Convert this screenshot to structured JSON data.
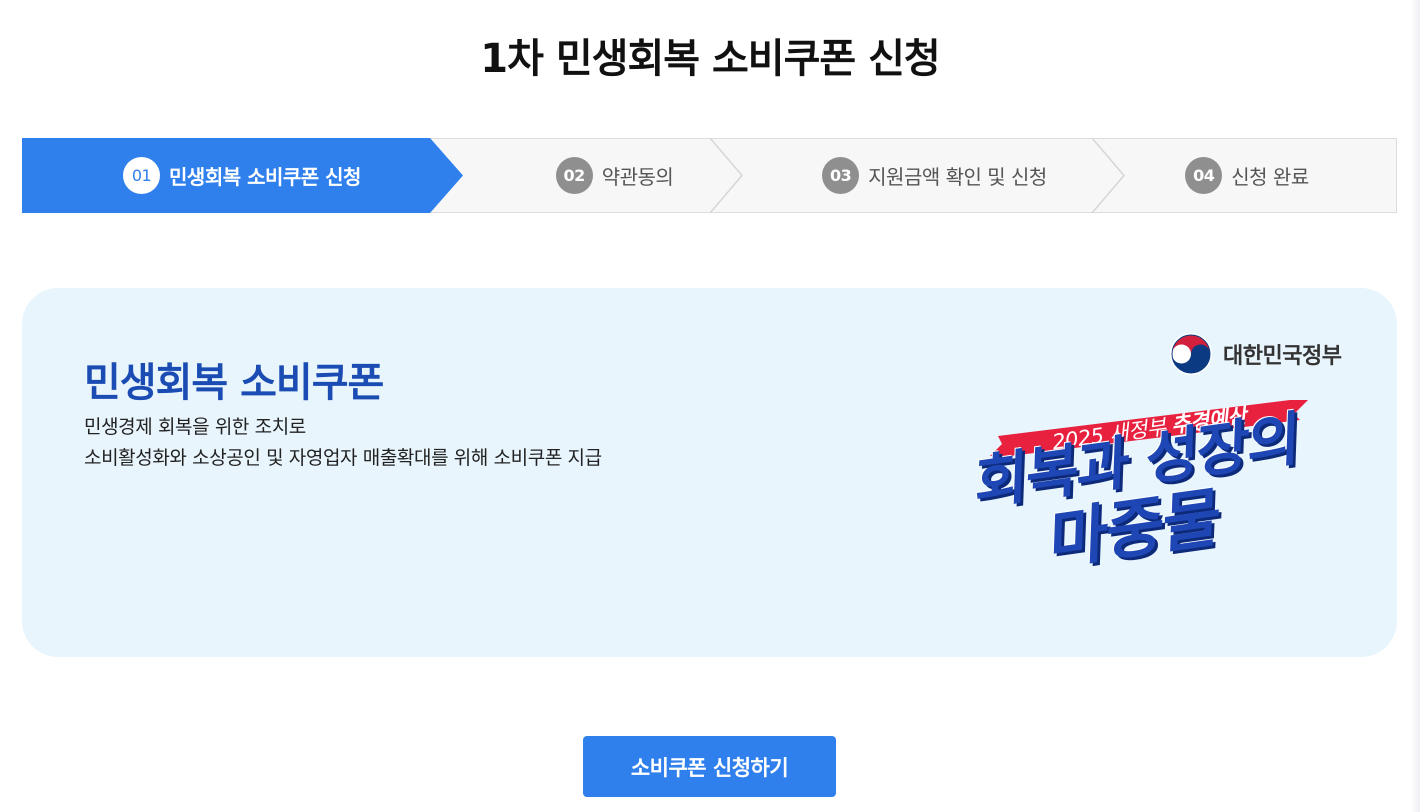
{
  "page_title": "1차 민생회복 소비쿠폰 신청",
  "steps": [
    {
      "num": "01",
      "label": "민생회복 소비쿠폰 신청",
      "active": true
    },
    {
      "num": "02",
      "label": "약관동의",
      "active": false
    },
    {
      "num": "03",
      "label": "지원금액 확인 및 신청",
      "active": false
    },
    {
      "num": "04",
      "label": "신청 완료",
      "active": false
    }
  ],
  "banner": {
    "title": "민생회복 소비쿠폰",
    "desc_line1": "민생경제 회복을 위한 조치로",
    "desc_line2": "소비활성화와 소상공인 및 자영업자 매출확대를 위해 소비쿠폰 지급",
    "gov_logo_text": "대한민국정부",
    "ribbon_text_a": "2025 새정부",
    "ribbon_text_b": "추경예산",
    "slogan_line1": "회복과 성장의",
    "slogan_line2": "마중물"
  },
  "apply_button": "소비쿠폰 신청하기",
  "colors": {
    "accent": "#2f80ed",
    "banner_bg": "#e8f5fc",
    "banner_title": "#1a4cb3",
    "ribbon": "#e8213f",
    "slogan": "#1e47b5"
  }
}
